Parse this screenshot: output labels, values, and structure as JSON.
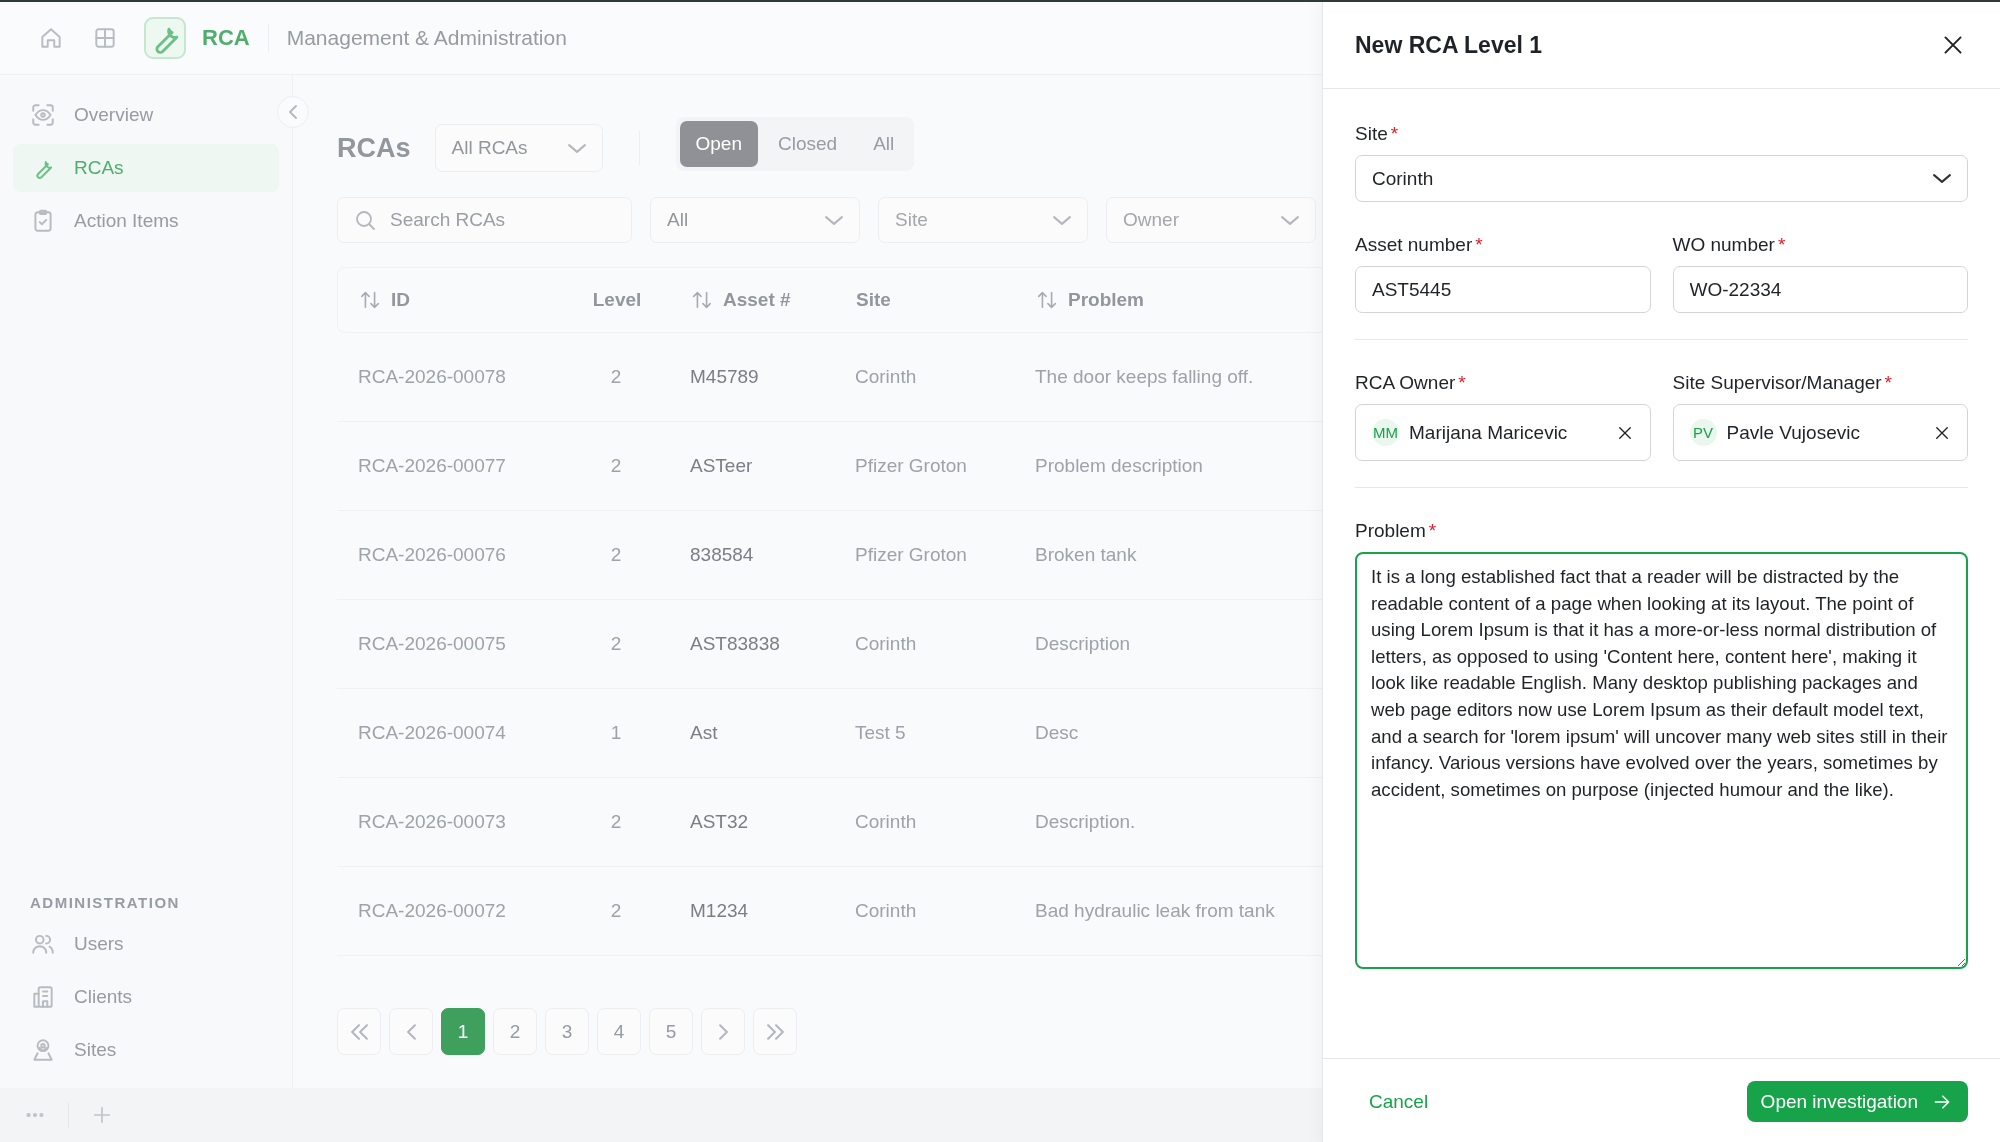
{
  "topbar": {
    "app_name": "RCA",
    "section": "Management & Administration"
  },
  "sidebar": {
    "items": [
      {
        "label": "Overview",
        "selected": false
      },
      {
        "label": "RCAs",
        "selected": true
      },
      {
        "label": "Action Items",
        "selected": false
      }
    ],
    "admin_heading": "ADMINISTRATION",
    "admin_items": [
      {
        "label": "Users",
        "selected": false
      },
      {
        "label": "Clients",
        "selected": false
      },
      {
        "label": "Sites",
        "selected": false
      }
    ]
  },
  "main": {
    "title": "RCAs",
    "view_select": "All RCAs",
    "status_tabs": [
      {
        "label": "Open",
        "selected": true
      },
      {
        "label": "Closed",
        "selected": false
      },
      {
        "label": "All",
        "selected": false
      }
    ],
    "search": {
      "placeholder": "Search RCAs"
    },
    "filters": [
      {
        "value": "All"
      },
      {
        "placeholder": "Site"
      },
      {
        "placeholder": "Owner"
      }
    ]
  },
  "table": {
    "columns": [
      {
        "label": "ID",
        "sortable": true
      },
      {
        "label": "Level",
        "sortable": false
      },
      {
        "label": "Asset #",
        "sortable": true
      },
      {
        "label": "Site",
        "sortable": false
      },
      {
        "label": "Problem",
        "sortable": true
      }
    ],
    "rows": [
      [
        "RCA-2026-00078",
        "2",
        "M45789",
        "Corinth",
        "The door keeps falling off."
      ],
      [
        "RCA-2026-00077",
        "2",
        "ASTeer",
        "Pfizer Groton",
        "Problem description"
      ],
      [
        "RCA-2026-00076",
        "2",
        "838584",
        "Pfizer Groton",
        "Broken tank"
      ],
      [
        "RCA-2026-00075",
        "2",
        "AST83838",
        "Corinth",
        "Description"
      ],
      [
        "RCA-2026-00074",
        "1",
        "Ast",
        "Test 5",
        "Desc"
      ],
      [
        "RCA-2026-00073",
        "2",
        "AST32",
        "Corinth",
        "Description."
      ],
      [
        "RCA-2026-00072",
        "2",
        "M1234",
        "Corinth",
        "Bad hydraulic leak from tank"
      ]
    ]
  },
  "pagination": {
    "pages": [
      {
        "label": "1",
        "selected": true
      },
      {
        "label": "2",
        "selected": false
      },
      {
        "label": "3",
        "selected": false
      },
      {
        "label": "4",
        "selected": false
      },
      {
        "label": "5",
        "selected": false
      }
    ]
  },
  "drawer": {
    "title": "New RCA Level 1",
    "site": {
      "label": "Site",
      "required_mark": "*",
      "value": "Corinth"
    },
    "asset_number": {
      "label": "Asset number",
      "required_mark": "*",
      "value": "AST5445"
    },
    "wo_number": {
      "label": "WO number",
      "required_mark": "*",
      "value": "WO-22334"
    },
    "rca_owner": {
      "label": "RCA Owner",
      "required_mark": "*",
      "initials": "MM",
      "name": "Marijana Maricevic"
    },
    "supervisor": {
      "label": "Site Supervisor/Manager",
      "required_mark": "*",
      "initials": "PV",
      "name": "Pavle Vujosevic"
    },
    "problem": {
      "label": "Problem",
      "required_mark": "*",
      "value": "It is a long established fact that a reader will be distracted by the readable content of a page when looking at its layout. The point of using Lorem Ipsum is that it has a more-or-less normal distribution of letters, as opposed to using 'Content here, content here', making it look like readable English. Many desktop publishing packages and web page editors now use Lorem Ipsum as their default model text, and a search for 'lorem ipsum' will uncover many web sites still in their infancy. Various versions have evolved over the years, sometimes by accident, sometimes on purpose (injected humour and the like)."
    },
    "cancel": "Cancel",
    "submit": "Open investigation"
  }
}
